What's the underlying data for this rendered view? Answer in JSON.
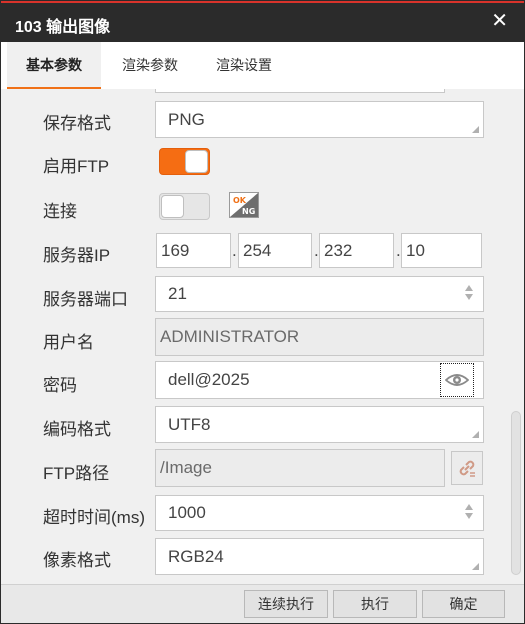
{
  "window": {
    "title": "103 输出图像",
    "close_icon": "close-icon"
  },
  "tabs": [
    {
      "label": "基本参数",
      "active": true
    },
    {
      "label": "渲染参数",
      "active": false
    },
    {
      "label": "渲染设置",
      "active": false
    }
  ],
  "form": {
    "save_format": {
      "label": "保存格式",
      "value": "PNG"
    },
    "enable_ftp": {
      "label": "启用FTP",
      "on": true
    },
    "connect": {
      "label": "连接",
      "on": false,
      "status_icon": "ok-ng-icon",
      "status_text_top": "OK",
      "status_text_bottom": "NG"
    },
    "server_ip": {
      "label": "服务器IP",
      "octets": [
        "169",
        "254",
        "232",
        "10"
      ],
      "separator": "."
    },
    "server_port": {
      "label": "服务器端口",
      "value": "21"
    },
    "username": {
      "label": "用户名",
      "value": "ADMINISTRATOR"
    },
    "password": {
      "label": "密码",
      "value": "dell@2025",
      "reveal_icon": "eye-icon"
    },
    "encoding": {
      "label": "编码格式",
      "value": "UTF8"
    },
    "ftp_path": {
      "label": "FTP路径",
      "value": "/Image",
      "link_icon": "link-icon"
    },
    "timeout": {
      "label": "超时时间(ms)",
      "value": "1000"
    },
    "pixel_format": {
      "label": "像素格式",
      "value": "RGB24"
    }
  },
  "footer": {
    "run_continuous": "连续执行",
    "run": "执行",
    "confirm": "确定"
  },
  "colors": {
    "accent": "#f56d13",
    "titlebar": "#2b2b2b",
    "titlebar_top_line": "#d9332b"
  }
}
